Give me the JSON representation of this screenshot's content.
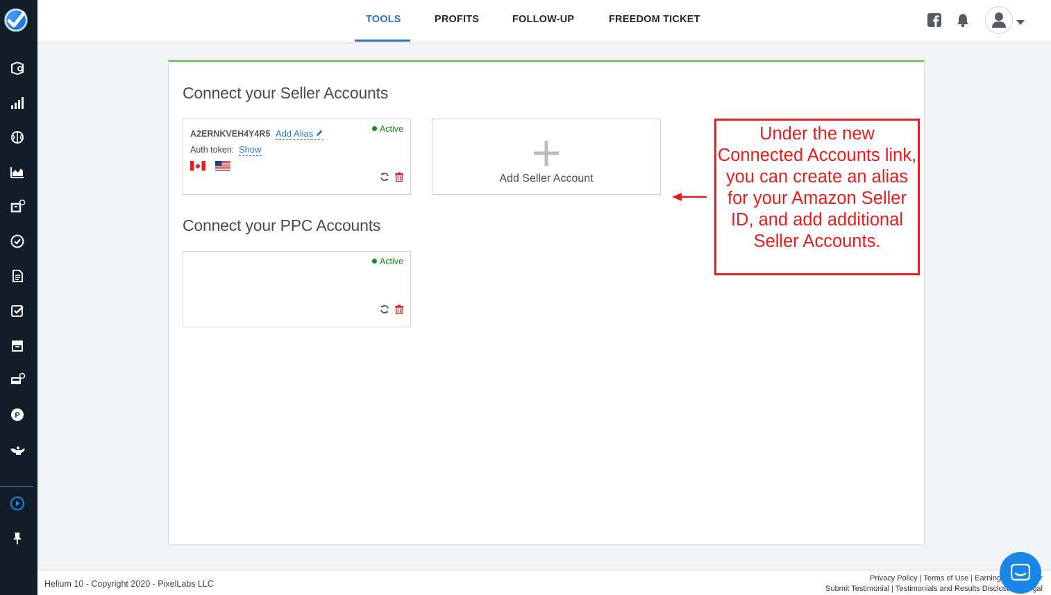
{
  "nav": {
    "tabs": [
      {
        "label": "TOOLS",
        "active": true
      },
      {
        "label": "PROFITS",
        "active": false
      },
      {
        "label": "FOLLOW-UP",
        "active": false
      },
      {
        "label": "FREEDOM TICKET",
        "active": false
      }
    ],
    "accent_color": "#2a76b7"
  },
  "sidebar": {
    "icons": [
      "black-box-icon",
      "keyword-tools-icon",
      "brain-icon",
      "market-tracker-icon",
      "refund-genie-icon",
      "check-icon",
      "document-icon",
      "checklist-icon",
      "inventory-icon",
      "alerts-icon",
      "profits-p-icon",
      "genie-lamp-icon",
      "play-icon",
      "pin-icon"
    ]
  },
  "seller_section": {
    "title": "Connect your Seller Accounts",
    "account": {
      "id": "A2ERNKVEH4Y4R5",
      "alias_link": "Add Alias",
      "auth_label": "Auth token:",
      "show_link": "Show",
      "status": "Active",
      "marketplaces": [
        "canada-flag",
        "usa-flag"
      ]
    },
    "add_label": "Add Seller Account"
  },
  "ppc_section": {
    "title": "Connect your PPC Accounts",
    "account": {
      "status": "Active"
    }
  },
  "annotation": {
    "text": "Under the new Connected Accounts link, you can create an alias for your Amazon Seller ID, and add additional Seller Accounts.",
    "color": "#e41e1e"
  },
  "footer": {
    "copyright": "Helium 10 - Copyright 2020 - PixelLabs LLC",
    "links_line1": [
      "Privacy Policy",
      "Terms of Use",
      "Earnings Disclaimer"
    ],
    "links_line2": [
      "Submit Testimonial",
      "Testimonials and Results Disclosure",
      "Legal"
    ]
  }
}
